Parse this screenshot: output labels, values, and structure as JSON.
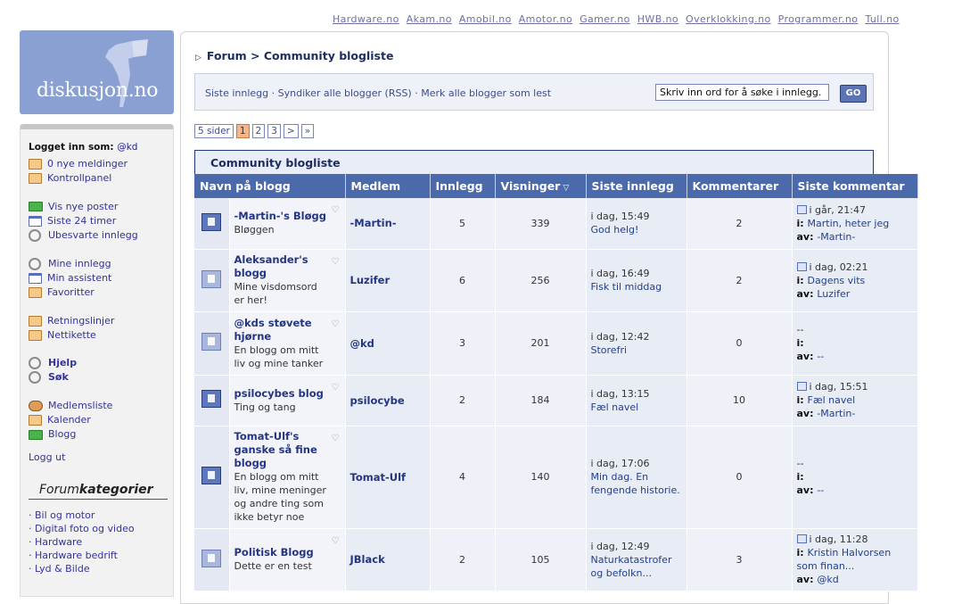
{
  "toplinks": [
    "Hardware.no",
    "Akam.no",
    "Amobil.no",
    "Amotor.no",
    "Gamer.no",
    "HWB.no",
    "Overklokking.no",
    "Programmer.no",
    "Tull.no"
  ],
  "logo": {
    "text": "diskusjon.no"
  },
  "sidebar": {
    "logged_in_label": "Logget inn som:",
    "username": "@kd",
    "group1": [
      {
        "label": "0 nye meldinger",
        "icon": "pen-icon"
      },
      {
        "label": "Kontrollpanel",
        "icon": "pen-icon"
      }
    ],
    "group2": [
      {
        "label": "Vis nye poster",
        "icon": "mail-icon"
      },
      {
        "label": "Siste 24 timer",
        "icon": "calendar-icon"
      },
      {
        "label": "Ubesvarte innlegg",
        "icon": "magnifier-icon"
      }
    ],
    "group3": [
      {
        "label": "Mine innlegg",
        "icon": "magnifier-icon"
      },
      {
        "label": "Min assistent",
        "icon": "calendar-icon"
      },
      {
        "label": "Favoritter",
        "icon": "pen-icon"
      }
    ],
    "group4": [
      {
        "label": "Retningslinjer",
        "icon": "pen-icon"
      },
      {
        "label": "Nettikette",
        "icon": "pen-icon"
      }
    ],
    "group5": [
      {
        "label": "Hjelp",
        "icon": "magnifier-icon"
      },
      {
        "label": "Søk",
        "icon": "magnifier-icon"
      }
    ],
    "group6": [
      {
        "label": "Medlemsliste",
        "icon": "people-icon"
      },
      {
        "label": "Kalender",
        "icon": "pen-icon"
      },
      {
        "label": "Blogg",
        "icon": "mail-icon"
      }
    ],
    "logout": "Logg ut",
    "categories_title_a": "Forum",
    "categories_title_b": "kategorier",
    "categories": [
      "· Bil og motor",
      "· Digital foto og video",
      "· Hardware",
      "· Hardware bedrift",
      "· Lyd & Bilde"
    ]
  },
  "breadcrumb": {
    "forum": "Forum",
    "sep": " > ",
    "current": "Community bloglist"
  },
  "toolbar": {
    "links": "Siste innlegg · Syndiker alle blogger (RSS) · Merk alle blogger som lest",
    "search_value": "Skriv inn ord for å søke i innlegg.",
    "go": "GO"
  },
  "pager": {
    "label": "5 sider",
    "pages": [
      "1",
      "2",
      "3"
    ],
    "next": ">",
    "last": "»"
  },
  "table": {
    "title": "Community blogliste",
    "columns": [
      "Navn på blogg",
      "Medlem",
      "Innlegg",
      "Visninger",
      "Siste innlegg",
      "Kommentarer",
      "Siste kommentar"
    ],
    "rows": [
      {
        "active": true,
        "title": "-Martin-'s Bløgg",
        "desc": "Bløggen",
        "member": "-Martin-",
        "posts": "5",
        "views": "339",
        "last_when": "i dag, 15:49",
        "last_title": "God helg!",
        "comments": "2",
        "c_when": "i går, 21:47",
        "c_i": "Martin, heter jeg",
        "c_av": "-Martin-",
        "c_icon": true
      },
      {
        "active": false,
        "title": "Aleksander's blogg",
        "desc": "Mine visdomsord er her!",
        "member": "Luzifer",
        "posts": "6",
        "views": "256",
        "last_when": "i dag, 16:49",
        "last_title": "Fisk til middag",
        "comments": "2",
        "c_when": "i dag, 02:21",
        "c_i": "Dagens vits",
        "c_av": "Luzifer",
        "c_icon": true
      },
      {
        "active": false,
        "title": "@kds støvete hjørne",
        "desc": "En blogg om mitt liv og mine tanker",
        "member": "@kd",
        "posts": "3",
        "views": "201",
        "last_when": "i dag, 12:42",
        "last_title": "Storefri",
        "comments": "0",
        "c_when": "--",
        "c_i": "",
        "c_av": "--",
        "c_icon": false
      },
      {
        "active": true,
        "title": "psilocybes blog",
        "desc": "Ting og tang",
        "member": "psilocybe",
        "posts": "2",
        "views": "184",
        "last_when": "i dag, 13:15",
        "last_title": "Fæl navel",
        "comments": "10",
        "c_when": "i dag, 15:51",
        "c_i": "Fæl navel",
        "c_av": "-Martin-",
        "c_icon": true
      },
      {
        "active": true,
        "title": "Tomat-Ulf's ganske så fine blogg",
        "desc": "En blogg om mitt liv, mine meninger og andre ting som ikke betyr noe",
        "member": "Tomat-Ulf",
        "posts": "4",
        "views": "140",
        "last_when": "i dag, 17:06",
        "last_title": "Min dag. En fengende historie.",
        "comments": "0",
        "c_when": "--",
        "c_i": "",
        "c_av": "--",
        "c_icon": false
      },
      {
        "active": false,
        "title": "Politisk Blogg",
        "desc": "Dette er en test",
        "member": "JBlack",
        "posts": "2",
        "views": "105",
        "last_when": "i dag, 12:49",
        "last_title": "Naturkatastrofer og befolkn...",
        "comments": "3",
        "c_when": "i dag, 11:28",
        "c_i": "Kristin Halvorsen som finan...",
        "c_av": "@kd",
        "c_icon": true
      }
    ]
  }
}
